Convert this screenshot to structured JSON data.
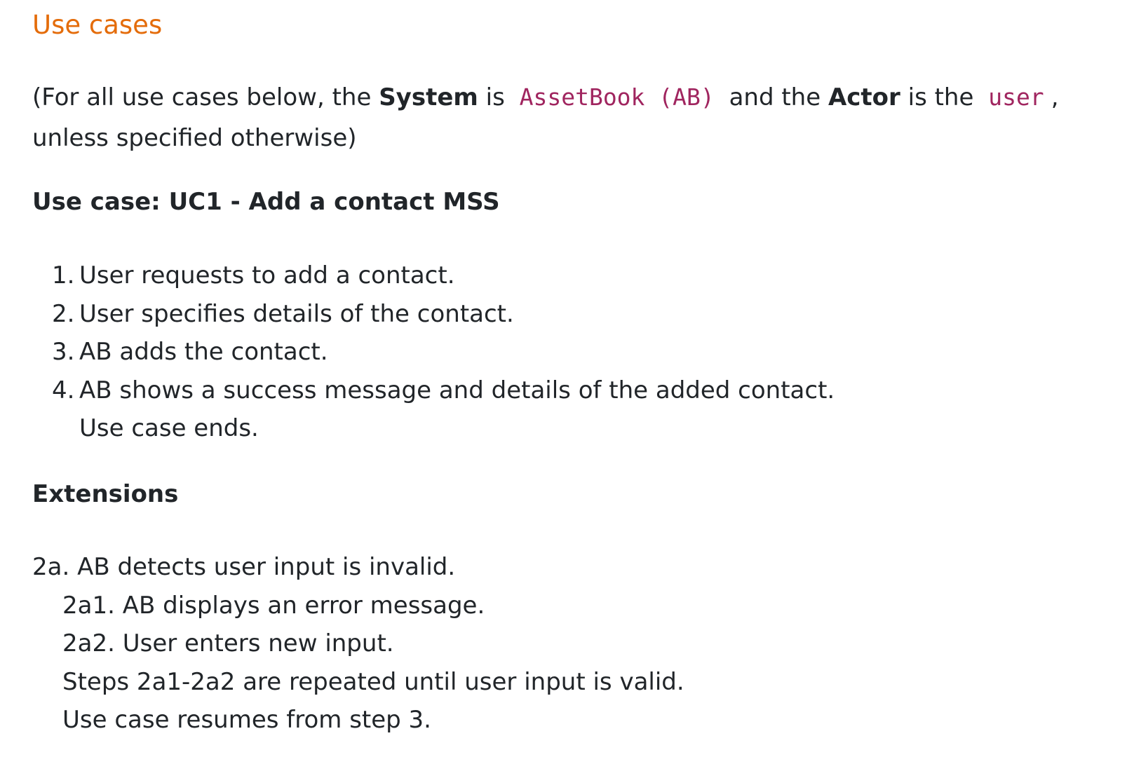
{
  "section_title": "Use cases",
  "intro": {
    "prefix": "(For all use cases below, the ",
    "system_label": "System",
    "is_text": " is ",
    "system_value": "AssetBook (AB)",
    "and_the": " and the ",
    "actor_label": "Actor",
    "is_the": " is the ",
    "actor_value": "user",
    "suffix": ", unless specified otherwise)",
    "code_color": "#a0255f"
  },
  "use_case": {
    "title": "Use case: UC1 - Add a contact MSS",
    "steps": [
      {
        "num": "1.",
        "text": "User requests to add a contact."
      },
      {
        "num": "2.",
        "text": "User specifies details of the contact."
      },
      {
        "num": "3.",
        "text": "AB adds the contact."
      },
      {
        "num": "4.",
        "text": "AB shows a success message and details of the added contact."
      }
    ],
    "end_note": "Use case ends."
  },
  "extensions": {
    "title": "Extensions",
    "heading": "2a. AB detects user input is invalid.",
    "lines": [
      "2a1. AB displays an error message.",
      "2a2. User enters new input.",
      "Steps 2a1-2a2 are repeated until user input is valid.",
      "Use case resumes from step 3."
    ]
  },
  "title_color": "#e46c0a"
}
